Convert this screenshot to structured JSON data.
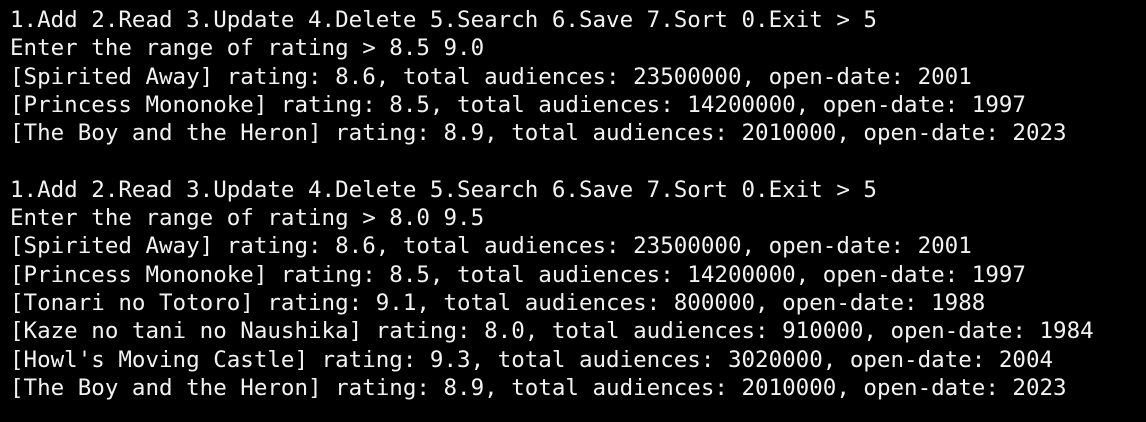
{
  "terminal": {
    "text_color": "#f2f2f2",
    "background_color": "#000000",
    "lines": [
      "1.Add 2.Read 3.Update 4.Delete 5.Search 6.Save 7.Sort 0.Exit > 5",
      "Enter the range of rating > 8.5 9.0",
      "[Spirited Away] rating: 8.6, total audiences: 23500000, open-date: 2001",
      "[Princess Mononoke] rating: 8.5, total audiences: 14200000, open-date: 1997",
      "[The Boy and the Heron] rating: 8.9, total audiences: 2010000, open-date: 2023",
      "",
      "1.Add 2.Read 3.Update 4.Delete 5.Search 6.Save 7.Sort 0.Exit > 5",
      "Enter the range of rating > 8.0 9.5",
      "[Spirited Away] rating: 8.6, total audiences: 23500000, open-date: 2001",
      "[Princess Mononoke] rating: 8.5, total audiences: 14200000, open-date: 1997",
      "[Tonari no Totoro] rating: 9.1, total audiences: 800000, open-date: 1988",
      "[Kaze no tani no Naushika] rating: 8.0, total audiences: 910000, open-date: 1984",
      "[Howl's Moving Castle] rating: 9.3, total audiences: 3020000, open-date: 2004",
      "[The Boy and the Heron] rating: 8.9, total audiences: 2010000, open-date: 2023"
    ]
  }
}
